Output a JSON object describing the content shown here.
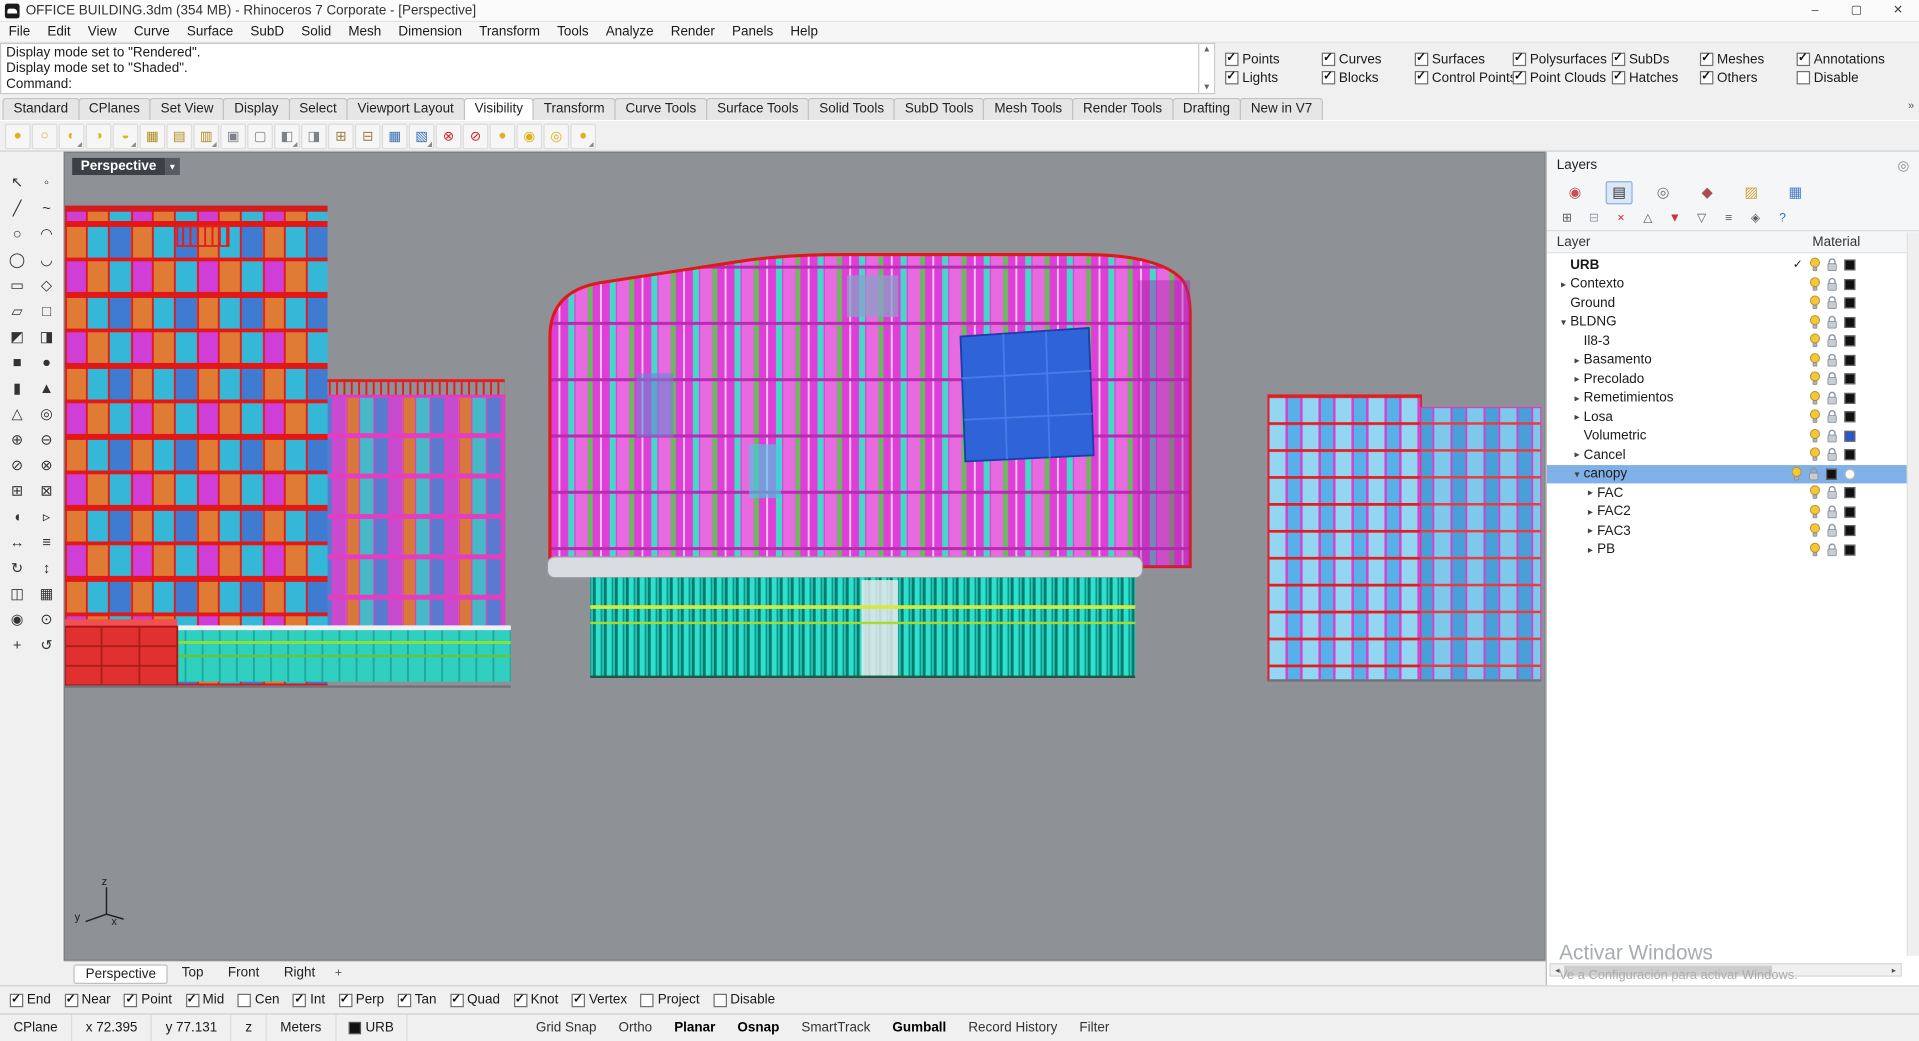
{
  "window": {
    "title": "OFFICE BUILDING.3dm (354 MB) - Rhinoceros 7 Corporate - [Perspective]",
    "controls": {
      "minimize": "–",
      "maximize": "▢",
      "close": "✕"
    }
  },
  "menu": {
    "items": [
      "File",
      "Edit",
      "View",
      "Curve",
      "Surface",
      "SubD",
      "Solid",
      "Mesh",
      "Dimension",
      "Transform",
      "Tools",
      "Analyze",
      "Render",
      "Panels",
      "Help"
    ]
  },
  "command": {
    "history": [
      "Display mode set to \"Rendered\".",
      "Display mode set to \"Shaded\"."
    ],
    "prompt": "Command:",
    "scroll_up": "▲",
    "scroll_down": "▼"
  },
  "selection_filter": {
    "row1": [
      {
        "label": "Points",
        "state": "checked"
      },
      {
        "label": "Curves",
        "state": "checked"
      },
      {
        "label": "Surfaces",
        "state": "checked"
      },
      {
        "label": "Polysurfaces",
        "state": "checked"
      },
      {
        "label": "SubDs",
        "state": "checked"
      },
      {
        "label": "Meshes",
        "state": "checked"
      },
      {
        "label": "Annotations",
        "state": "checked"
      }
    ],
    "row2": [
      {
        "label": "Lights",
        "state": "checked"
      },
      {
        "label": "Blocks",
        "state": "checked"
      },
      {
        "label": "Control Points",
        "state": "checked"
      },
      {
        "label": "Point Clouds",
        "state": "checked"
      },
      {
        "label": "Hatches",
        "state": "checked"
      },
      {
        "label": "Others",
        "state": "checked"
      },
      {
        "label": "Disable",
        "state": ""
      }
    ]
  },
  "toolbar_tabs": {
    "overflow": "»",
    "items": [
      {
        "label": "Standard",
        "state": ""
      },
      {
        "label": "CPlanes",
        "state": ""
      },
      {
        "label": "Set View",
        "state": ""
      },
      {
        "label": "Display",
        "state": ""
      },
      {
        "label": "Select",
        "state": ""
      },
      {
        "label": "Viewport Layout",
        "state": ""
      },
      {
        "label": "Visibility",
        "state": "active"
      },
      {
        "label": "Transform",
        "state": ""
      },
      {
        "label": "Curve Tools",
        "state": ""
      },
      {
        "label": "Surface Tools",
        "state": ""
      },
      {
        "label": "Solid Tools",
        "state": ""
      },
      {
        "label": "SubD Tools",
        "state": ""
      },
      {
        "label": "Mesh Tools",
        "state": ""
      },
      {
        "label": "Render Tools",
        "state": ""
      },
      {
        "label": "Drafting",
        "state": ""
      },
      {
        "label": "New in V7",
        "state": ""
      }
    ]
  },
  "visibility_toolbar": {
    "items": [
      {
        "icon": "hide-objects-bulb-icon",
        "glyph": "●",
        "color": "#e0b11e"
      },
      {
        "icon": "show-objects-bulb-icon",
        "glyph": "○",
        "color": "#e0b11e"
      },
      {
        "icon": "swap-hidden-bulb-icon",
        "glyph": "◐",
        "color": "#e0b11e",
        "state": "fly"
      },
      {
        "icon": "isolate-objects-bulb-icon",
        "glyph": "◑",
        "color": "#e0b11e"
      },
      {
        "icon": "show-selected-bulb-icon",
        "glyph": "◒",
        "color": "#e0b11e",
        "state": "fly"
      },
      {
        "icon": "layer-lights-grid-icon",
        "glyph": "▦",
        "color": "#b08d20"
      },
      {
        "icon": "layer-on-grid-icon",
        "glyph": "▤",
        "color": "#b08d20"
      },
      {
        "icon": "layer-off-grid-icon",
        "glyph": "▥",
        "color": "#b08d20",
        "state": "fly"
      },
      {
        "icon": "lock-objects-icon",
        "glyph": "▣",
        "color": "#7d8288"
      },
      {
        "icon": "unlock-objects-icon",
        "glyph": "▢",
        "color": "#7d8288"
      },
      {
        "icon": "swap-locked-icon",
        "glyph": "◧",
        "color": "#7d8288",
        "state": "fly"
      },
      {
        "icon": "unlock-selected-icon",
        "glyph": "◨",
        "color": "#7d8288"
      },
      {
        "icon": "copy-layer-state-icon",
        "glyph": "⊞",
        "color": "#9a7b3a"
      },
      {
        "icon": "paste-layer-state-icon",
        "glyph": "⊟",
        "color": "#9a7b3a"
      },
      {
        "icon": "select-visible-icon",
        "glyph": "▦",
        "color": "#3a6fb5"
      },
      {
        "icon": "select-hidden-icon",
        "glyph": "▧",
        "color": "#3a6fb5",
        "state": "fly"
      },
      {
        "icon": "bulb-off-red-icon",
        "glyph": "⊗",
        "color": "#cc2222"
      },
      {
        "icon": "bulb-disable-red-icon",
        "glyph": "⊘",
        "color": "#cc2222"
      },
      {
        "icon": "one-bulb-icon",
        "glyph": "●",
        "color": "#e0b11e"
      },
      {
        "icon": "two-bulbs-icon",
        "glyph": "◉",
        "color": "#e0b11e"
      },
      {
        "icon": "three-bulbs-icon",
        "glyph": "◎",
        "color": "#e0b11e"
      },
      {
        "icon": "bulb-group-icon",
        "glyph": "●",
        "color": "#e0b11e",
        "state": "fly"
      }
    ]
  },
  "left_toolbar": {
    "items": [
      {
        "icon": "select-tool-icon",
        "glyph": "↖"
      },
      {
        "icon": "point-tool-icon",
        "glyph": "◦"
      },
      {
        "icon": "polyline-tool-icon",
        "glyph": "╱"
      },
      {
        "icon": "curve-tool-icon",
        "glyph": "~"
      },
      {
        "icon": "circle-tool-icon",
        "glyph": "○"
      },
      {
        "icon": "arc-tool-icon",
        "glyph": "◠"
      },
      {
        "icon": "ellipse-tool-icon",
        "glyph": "◯"
      },
      {
        "icon": "freeform-tool-icon",
        "glyph": "◡"
      },
      {
        "icon": "rectangle-tool-icon",
        "glyph": "▭"
      },
      {
        "icon": "polygon-tool-icon",
        "glyph": "◇"
      },
      {
        "icon": "surface-tool-icon",
        "glyph": "▱"
      },
      {
        "icon": "plane-tool-icon",
        "glyph": "□"
      },
      {
        "icon": "loft-tool-icon",
        "glyph": "◩"
      },
      {
        "icon": "extrude-tool-icon",
        "glyph": "◨"
      },
      {
        "icon": "box-tool-icon",
        "glyph": "■"
      },
      {
        "icon": "sphere-tool-icon",
        "glyph": "●"
      },
      {
        "icon": "cylinder-tool-icon",
        "glyph": "▮"
      },
      {
        "icon": "cone-tool-icon",
        "glyph": "▲"
      },
      {
        "icon": "pyramid-tool-icon",
        "glyph": "△"
      },
      {
        "icon": "torus-tool-icon",
        "glyph": "◎"
      },
      {
        "icon": "boolean-union-tool-icon",
        "glyph": "⊕"
      },
      {
        "icon": "boolean-difference-tool-icon",
        "glyph": "⊖"
      },
      {
        "icon": "trim-tool-icon",
        "glyph": "⊘"
      },
      {
        "icon": "split-tool-icon",
        "glyph": "⊗"
      },
      {
        "icon": "join-tool-icon",
        "glyph": "⊞"
      },
      {
        "icon": "explode-tool-icon",
        "glyph": "⊠"
      },
      {
        "icon": "fillet-tool-icon",
        "glyph": "◖"
      },
      {
        "icon": "chamfer-tool-icon",
        "glyph": "▹"
      },
      {
        "icon": "move-tool-icon",
        "glyph": "↔"
      },
      {
        "icon": "copy-tool-icon",
        "glyph": "≡"
      },
      {
        "icon": "rotate-tool-icon",
        "glyph": "↻"
      },
      {
        "icon": "scale-tool-icon",
        "glyph": "↕"
      },
      {
        "icon": "mirror-tool-icon",
        "glyph": "◫"
      },
      {
        "icon": "array-tool-icon",
        "glyph": "▦"
      },
      {
        "icon": "gumball-tool-icon",
        "glyph": "◉"
      },
      {
        "icon": "zoom-tool-icon",
        "glyph": "⊙"
      },
      {
        "icon": "pan-tool-icon",
        "glyph": "+"
      },
      {
        "icon": "undo-view-tool-icon",
        "glyph": "↺"
      }
    ]
  },
  "viewport": {
    "label": "Perspective",
    "dropdown": "▾",
    "axis": {
      "x": "x",
      "y": "y",
      "z": "z"
    },
    "tabs": [
      {
        "label": "Perspective",
        "state": "active"
      },
      {
        "label": "Top",
        "state": ""
      },
      {
        "label": "Front",
        "state": ""
      },
      {
        "label": "Right",
        "state": ""
      }
    ],
    "new_view": "+"
  },
  "layers_panel": {
    "title": "Layers",
    "gear": "◎",
    "panel_tabs": [
      {
        "icon": "properties-tab-icon",
        "glyph": "◉",
        "color": "#c85050"
      },
      {
        "icon": "layers-tab-icon",
        "glyph": "▤",
        "color": "#2b2f33",
        "state": "active"
      },
      {
        "icon": "display-tab-icon",
        "glyph": "◎",
        "color": "#6a7078"
      },
      {
        "icon": "materials-tab-icon",
        "glyph": "◆",
        "color": "#a85050"
      },
      {
        "icon": "libraries-tab-icon",
        "glyph": "▨",
        "color": "#c8a23a"
      },
      {
        "icon": "rendering-tab-icon",
        "glyph": "▦",
        "color": "#4a7ac9"
      }
    ],
    "toolbar": [
      {
        "icon": "new-layer-icon",
        "glyph": "⊞",
        "color": "#5a6066"
      },
      {
        "icon": "new-sublayer-icon",
        "glyph": "⊟",
        "color": "#9aa0a6"
      },
      {
        "icon": "delete-layer-icon",
        "glyph": "×",
        "color": "#cc2222"
      },
      {
        "icon": "move-up-layer-icon",
        "glyph": "△",
        "color": "#5a6066"
      },
      {
        "icon": "filter-layers-icon",
        "glyph": "▼",
        "color": "#cc3333"
      },
      {
        "icon": "named-filter-icon",
        "glyph": "▽",
        "color": "#5a6066"
      },
      {
        "icon": "layer-list-icon",
        "glyph": "≡",
        "color": "#5a6066"
      },
      {
        "icon": "layer-tools-icon",
        "glyph": "◈",
        "color": "#5a6066"
      },
      {
        "icon": "layer-help-icon",
        "glyph": "?",
        "color": "#2b6fc9"
      }
    ],
    "columns": {
      "layer": "Layer",
      "material": "Material"
    },
    "rows": [
      {
        "name": "URB",
        "arrow": "",
        "check": "✓",
        "state": "bold",
        "mat": "#111111"
      },
      {
        "name": "Contexto",
        "arrow": "▸",
        "check": "",
        "state": "",
        "mat": "#111111"
      },
      {
        "name": "Ground",
        "arrow": "",
        "check": "",
        "state": "",
        "mat": "#111111"
      },
      {
        "name": "BLDNG",
        "arrow": "▾",
        "check": "",
        "state": "",
        "mat": "#111111"
      },
      {
        "name": "Il8-3",
        "arrow": "",
        "check": "",
        "state": "ind1",
        "mat": "#111111"
      },
      {
        "name": "Basamento",
        "arrow": "▸",
        "check": "",
        "state": "ind1",
        "mat": "#111111"
      },
      {
        "name": "Precolado",
        "arrow": "▸",
        "check": "",
        "state": "ind1",
        "mat": "#111111"
      },
      {
        "name": "Remetimientos",
        "arrow": "▸",
        "check": "",
        "state": "ind1",
        "mat": "#111111"
      },
      {
        "name": "Losa",
        "arrow": "▸",
        "check": "",
        "state": "ind1",
        "mat": "#111111"
      },
      {
        "name": "Volumetric",
        "arrow": "",
        "check": "",
        "state": "ind1",
        "mat": "#2b57c8"
      },
      {
        "name": "Cancel",
        "arrow": "▸",
        "check": "",
        "state": "ind1",
        "mat": "#111111"
      },
      {
        "name": "canopy",
        "arrow": "▾",
        "check": "",
        "state": "ind1 selected dot",
        "mat": "#111111"
      },
      {
        "name": "FAC",
        "arrow": "▸",
        "check": "",
        "state": "ind2",
        "mat": "#111111"
      },
      {
        "name": "FAC2",
        "arrow": "▸",
        "check": "",
        "state": "ind2",
        "mat": "#111111"
      },
      {
        "name": "FAC3",
        "arrow": "▸",
        "check": "",
        "state": "ind2",
        "mat": "#111111"
      },
      {
        "name": "PB",
        "arrow": "▸",
        "check": "",
        "state": "ind2",
        "mat": "#111111"
      }
    ],
    "watermark": {
      "line1": "Activar Windows",
      "line2": "Ve a Configuración para activar Windows."
    },
    "hscroll": {
      "left": "◂",
      "right": "▸"
    }
  },
  "osnap": {
    "items": [
      {
        "label": "End",
        "state": "checked"
      },
      {
        "label": "Near",
        "state": "checked"
      },
      {
        "label": "Point",
        "state": "checked"
      },
      {
        "label": "Mid",
        "state": "checked"
      },
      {
        "label": "Cen",
        "state": ""
      },
      {
        "label": "Int",
        "state": "checked"
      },
      {
        "label": "Perp",
        "state": "checked"
      },
      {
        "label": "Tan",
        "state": "checked"
      },
      {
        "label": "Quad",
        "state": "checked"
      },
      {
        "label": "Knot",
        "state": "checked"
      },
      {
        "label": "Vertex",
        "state": "checked"
      },
      {
        "label": "Project",
        "state": ""
      },
      {
        "label": "Disable",
        "state": ""
      }
    ]
  },
  "status_bar": {
    "cells": [
      {
        "label": "CPlane"
      },
      {
        "label": "x 72.395"
      },
      {
        "label": "y 77.131"
      },
      {
        "label": "z"
      },
      {
        "label": "Meters"
      }
    ],
    "layer_chip": {
      "label": "URB",
      "color": "#111111"
    },
    "toggles": [
      {
        "label": "Grid Snap",
        "state": ""
      },
      {
        "label": "Ortho",
        "state": ""
      },
      {
        "label": "Planar",
        "state": "active"
      },
      {
        "label": "Osnap",
        "state": "active"
      },
      {
        "label": "SmartTrack",
        "state": ""
      },
      {
        "label": "Gumball",
        "state": "active"
      },
      {
        "label": "Record History",
        "state": ""
      },
      {
        "label": "Filter",
        "state": ""
      }
    ]
  },
  "model_colors": {
    "viewport_background": "#8e9296",
    "facade_magenta": "#df3fd8",
    "facade_cyan": "#35b8d8",
    "facade_orange": "#e07b35",
    "facade_blue": "#3f7bd0",
    "glass_blue": "#2f63d8",
    "podium_teal": "#2fd0c0",
    "outline_red": "#e02020",
    "stripe_yellow_green": "#d9e83a"
  }
}
